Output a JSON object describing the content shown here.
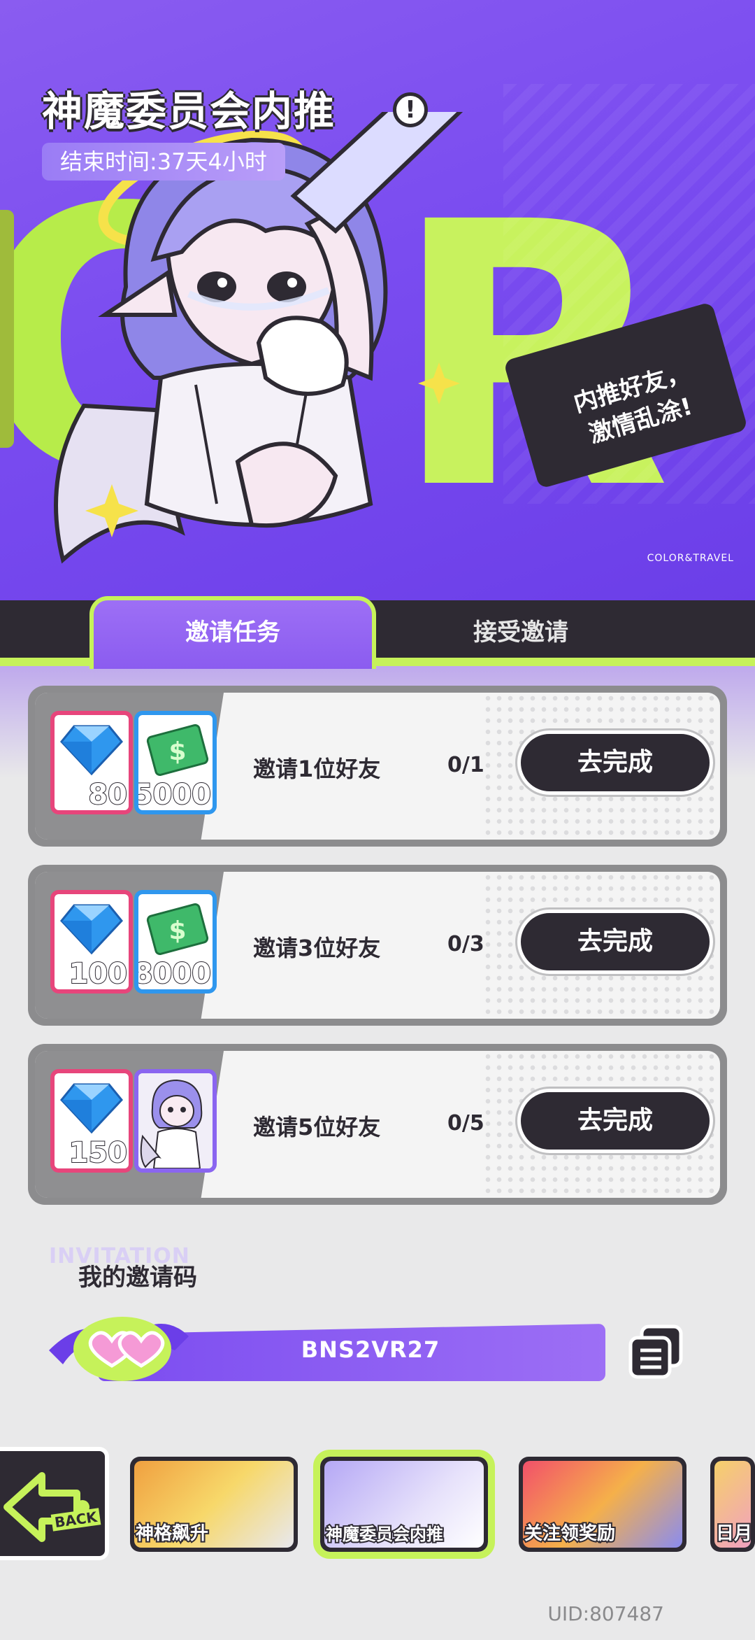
{
  "event": {
    "title": "神魔委员会内推",
    "end_time": "结束时间:37天4小时",
    "speech_line1": "内推好友，",
    "speech_line2": "激情乱涂!",
    "hero_logo": "COLOR&TRAVEL"
  },
  "tabs": [
    {
      "label": "邀请任务",
      "active": true
    },
    {
      "label": "接受邀请",
      "active": false
    }
  ],
  "tasks": [
    {
      "label": "邀请1位好友",
      "progress": "0/1",
      "button": "去完成",
      "rewards": [
        {
          "icon": "diamond-icon",
          "amount": "80"
        },
        {
          "icon": "cash-icon",
          "amount": "5000"
        }
      ]
    },
    {
      "label": "邀请3位好友",
      "progress": "0/3",
      "button": "去完成",
      "rewards": [
        {
          "icon": "diamond-icon",
          "amount": "100"
        },
        {
          "icon": "cash-icon",
          "amount": "8000"
        }
      ]
    },
    {
      "label": "邀请5位好友",
      "progress": "0/5",
      "button": "去完成",
      "rewards": [
        {
          "icon": "diamond-icon",
          "amount": "150"
        },
        {
          "icon": "character-portrait",
          "amount": ""
        }
      ]
    }
  ],
  "invite": {
    "watermark": "INVITATION",
    "title": "我的邀请码",
    "code": "BNS2VR27"
  },
  "bottom_nav": {
    "back_label": "BACK",
    "items": [
      {
        "label": "神格飙升",
        "active": false
      },
      {
        "label": "神魔委员会内推",
        "active": true
      },
      {
        "label": "关注领奖励",
        "active": false
      },
      {
        "label": "日月",
        "active": false
      }
    ]
  },
  "uid": "UID:807487",
  "colors": {
    "accent_purple": "#8b5cf0",
    "accent_lime": "#c6f25a",
    "dark": "#2e2a33",
    "pink": "#e7457b",
    "blue": "#2f97ee"
  }
}
